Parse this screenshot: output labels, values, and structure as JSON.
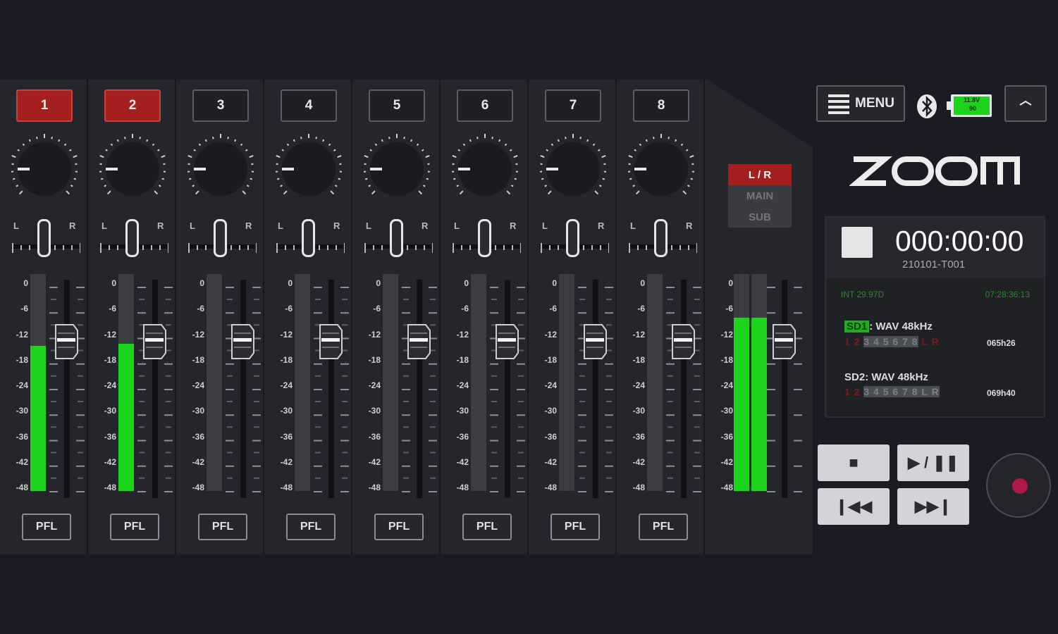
{
  "channels": [
    {
      "label": "1",
      "active": true,
      "level": 0.67
    },
    {
      "label": "2",
      "active": true,
      "level": 0.68
    },
    {
      "label": "3",
      "active": false,
      "level": 0
    },
    {
      "label": "4",
      "active": false,
      "level": 0
    },
    {
      "label": "5",
      "active": false,
      "level": 0
    },
    {
      "label": "6",
      "active": false,
      "level": 0
    },
    {
      "label": "7",
      "active": false,
      "level": 0
    },
    {
      "label": "8",
      "active": false,
      "level": 0
    }
  ],
  "pan_labels": {
    "left": "L",
    "right": "R"
  },
  "scale_marks": [
    "0",
    "-6",
    "-12",
    "-18",
    "-24",
    "-30",
    "-36",
    "-42",
    "-48"
  ],
  "pfl_label": "PFL",
  "master": {
    "bus_items": [
      {
        "label": "L / R",
        "active": true
      },
      {
        "label": "MAIN",
        "active": false
      },
      {
        "label": "SUB",
        "active": false
      }
    ],
    "levels": [
      0.8,
      0.8
    ]
  },
  "header": {
    "menu_label": "MENU",
    "battery_text_1": "11.8V",
    "battery_text_2": "90",
    "brand": "ZOOM"
  },
  "recorder": {
    "timecode": "000:00:00",
    "take": "210101-T001",
    "int_label": "INT 29.97D",
    "clock": "07:28:36:13",
    "sd1": {
      "tag": "SD1",
      "format": ": WAV 48kHz",
      "tracks_red": "1 2",
      "tracks_grey": "3 4 5 6 7 8",
      "tracks_tail": "L R",
      "time": "065h26"
    },
    "sd2": {
      "tag": "SD2",
      "format": ": WAV 48kHz",
      "tracks_red": "1 2",
      "tracks_grey": "3 4 5 6 7 8 L R",
      "time": "069h40"
    }
  },
  "transport": {
    "stop": "■",
    "play_pause": "▶ / ❚❚",
    "prev": "❙◀◀",
    "next": "▶▶❙"
  },
  "colors": {
    "active_red": "#a61f1f",
    "meter_green": "#1dd41d",
    "bg": "#1b1c23",
    "record": "#b0184a"
  }
}
